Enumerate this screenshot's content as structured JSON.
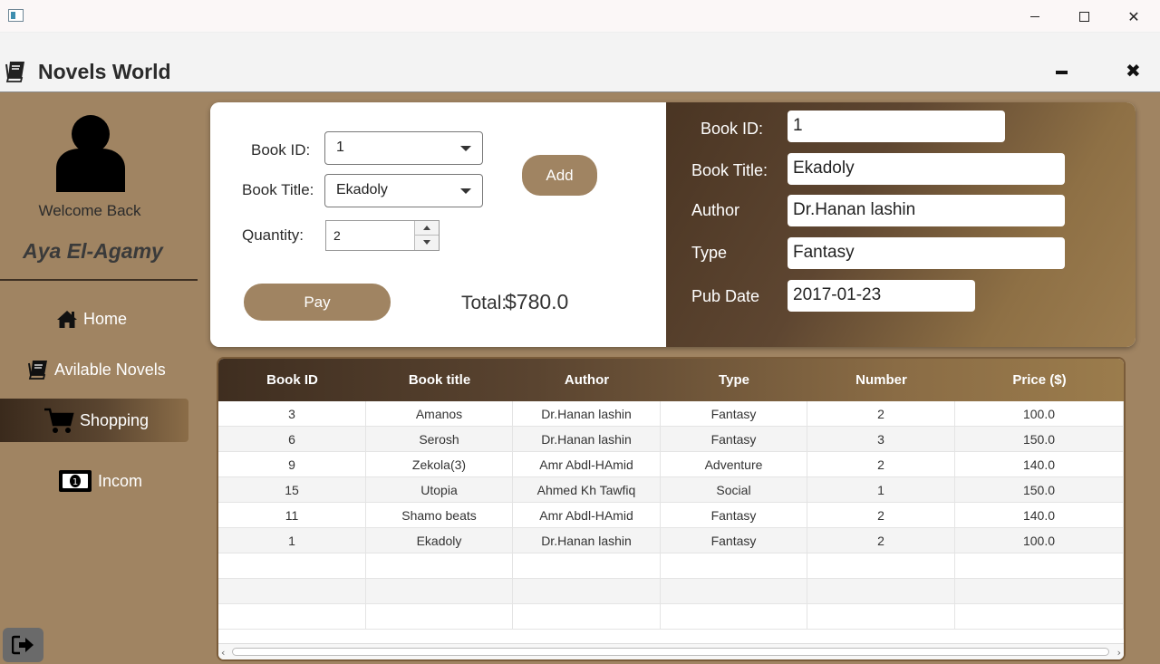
{
  "window": {
    "close_glyph": "✕"
  },
  "header": {
    "title": "Novels World",
    "close_glyph": "✖"
  },
  "sidebar": {
    "welcome": "Welcome Back",
    "username": "Aya El-Agamy",
    "items": [
      {
        "label": "Home",
        "icon": "home-icon"
      },
      {
        "label": "Avilable Novels",
        "icon": "book-icon"
      },
      {
        "label": "Shopping",
        "icon": "cart-icon",
        "active": true
      },
      {
        "label": "Incom",
        "icon": "money-icon"
      }
    ]
  },
  "order_form": {
    "book_id_label": "Book ID:",
    "book_id_value": "1",
    "book_title_label": "Book Title:",
    "book_title_value": "Ekadoly",
    "quantity_label": "Quantity:",
    "quantity_value": "2",
    "add_label": "Add",
    "pay_label": "Pay",
    "total_label": "Total:",
    "total_value": "$780.0"
  },
  "details": {
    "book_id_label": "Book ID:",
    "book_id_value": "1",
    "book_title_label": "Book Title:",
    "book_title_value": "Ekadoly",
    "author_label": "Author",
    "author_value": "Dr.Hanan lashin",
    "type_label": "Type",
    "type_value": "Fantasy",
    "pub_date_label": "Pub Date",
    "pub_date_value": "2017-01-23"
  },
  "table": {
    "columns": [
      "Book ID",
      "Book title",
      "Author",
      "Type",
      "Number",
      "Price ($)"
    ],
    "rows": [
      [
        "3",
        "Amanos",
        "Dr.Hanan lashin",
        "Fantasy",
        "2",
        "100.0"
      ],
      [
        "6",
        "Serosh",
        "Dr.Hanan lashin",
        "Fantasy",
        "3",
        "150.0"
      ],
      [
        "9",
        "Zekola(3)",
        "Amr Abdl-HAmid",
        "Adventure",
        "2",
        "140.0"
      ],
      [
        "15",
        "Utopia",
        "Ahmed Kh Tawfiq",
        "Social",
        "1",
        "150.0"
      ],
      [
        "11",
        "Shamo beats",
        "Amr Abdl-HAmid",
        "Fantasy",
        "2",
        "140.0"
      ],
      [
        "1",
        "Ekadoly",
        "Dr.Hanan lashin",
        "Fantasy",
        "2",
        "100.0"
      ]
    ]
  },
  "colors": {
    "sidebar_bg": "#a08462",
    "accent_dark": "#4a3523",
    "button": "#a08462"
  }
}
